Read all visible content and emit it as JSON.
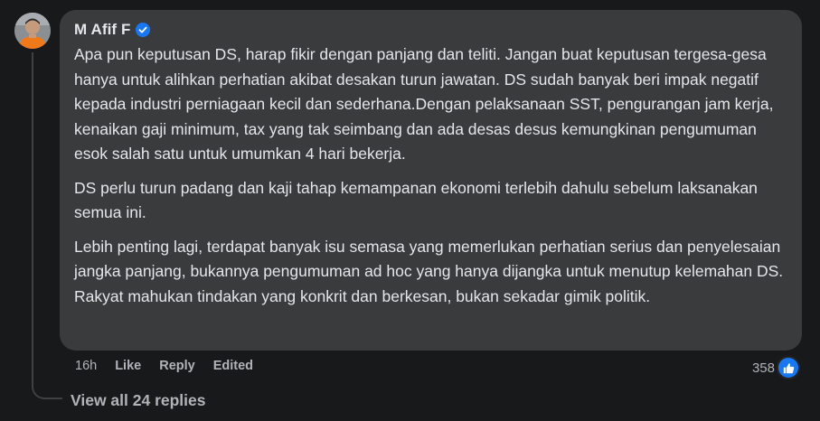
{
  "comment": {
    "author": "M Afif F",
    "verified": true,
    "paragraphs": [
      "Apa pun keputusan DS, harap fikir dengan panjang dan teliti. Jangan buat keputusan tergesa-gesa hanya untuk alihkan perhatian akibat desakan turun jawatan. DS sudah banyak beri impak negatif kepada industri perniagaan kecil dan sederhana.Dengan pelaksanaan SST, pengurangan jam kerja, kenaikan gaji minimum, tax yang tak seimbang dan ada desas desus kemungkinan pengumuman esok salah satu untuk umumkan 4 hari bekerja.",
      "DS perlu turun padang dan kaji tahap kemampanan ekonomi terlebih dahulu sebelum laksanakan semua ini.",
      "Lebih penting lagi, terdapat banyak isu semasa yang memerlukan perhatian serius dan penyelesaian jangka panjang, bukannya pengumuman ad hoc yang hanya dijangka untuk menutup kelemahan DS. Rakyat mahukan tindakan yang konkrit dan berkesan, bukan sekadar gimik politik."
    ],
    "time": "16h",
    "like_label": "Like",
    "reply_label": "Reply",
    "edited_label": "Edited",
    "reaction_count": "358",
    "reaction_icon": "thumbs-up-icon"
  },
  "view_replies_label": "View all 24 replies",
  "colors": {
    "background": "#18191a",
    "bubble": "#3a3b3c",
    "text": "#e4e6eb",
    "secondary_text": "#b0b3b8",
    "accent": "#1877f2"
  }
}
